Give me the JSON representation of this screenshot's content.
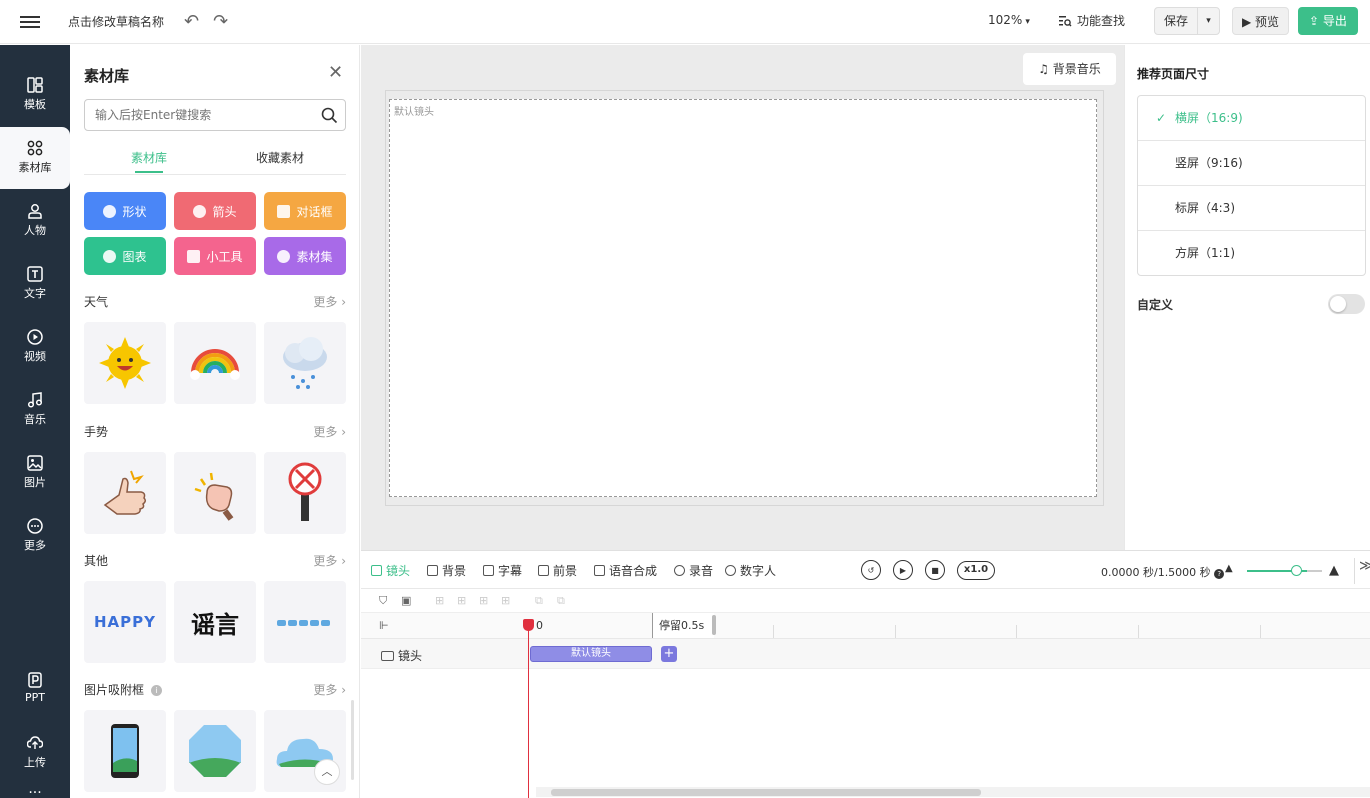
{
  "topbar": {
    "draft_name": "点击修改草稿名称",
    "zoom": "102%",
    "func_search": "功能查找",
    "save": "保存",
    "preview": "预览",
    "export": "导出"
  },
  "nav": {
    "items": [
      {
        "label": "模板",
        "icon": "template-icon"
      },
      {
        "label": "素材库",
        "icon": "material-library-icon"
      },
      {
        "label": "人物",
        "icon": "person-icon"
      },
      {
        "label": "文字",
        "icon": "text-icon"
      },
      {
        "label": "视频",
        "icon": "video-icon"
      },
      {
        "label": "音乐",
        "icon": "music-icon"
      },
      {
        "label": "图片",
        "icon": "image-icon"
      },
      {
        "label": "更多",
        "icon": "more-icon"
      },
      {
        "label": "PPT",
        "icon": "ppt-icon"
      },
      {
        "label": "上传",
        "icon": "upload-icon"
      }
    ],
    "overflow": "···"
  },
  "panel": {
    "title": "素材库",
    "search_placeholder": "输入后按Enter键搜索",
    "tabs": [
      "素材库",
      "收藏素材"
    ],
    "categories": [
      {
        "label": "形状",
        "color": "#4a86f7"
      },
      {
        "label": "箭头",
        "color": "#f06a73"
      },
      {
        "label": "对话框",
        "color": "#f5a742"
      },
      {
        "label": "图表",
        "color": "#2ec28f"
      },
      {
        "label": "小工具",
        "color": "#f4648e"
      },
      {
        "label": "素材集",
        "color": "#a86ae8"
      }
    ],
    "sections": [
      {
        "title": "天气",
        "more": "更多"
      },
      {
        "title": "手势",
        "more": "更多"
      },
      {
        "title": "其他",
        "more": "更多"
      },
      {
        "title": "图片吸附框",
        "more": "更多"
      }
    ],
    "other_texts": [
      "HAPPY",
      "谣言"
    ]
  },
  "canvas": {
    "bgm": "背景音乐",
    "stage_label": "默认镜头"
  },
  "right": {
    "title": "推荐页面尺寸",
    "sizes": [
      "横屏（16:9)",
      "竖屏（9:16)",
      "标屏（4:3)",
      "方屏（1:1)"
    ],
    "custom": "自定义"
  },
  "timeline": {
    "tabs": [
      "镜头",
      "背景",
      "字幕",
      "前景",
      "语音合成",
      "录音",
      "数字人"
    ],
    "speed": "x1.0",
    "timecode": "0.0000 秒/1.5000 秒",
    "ruler_zero": "0",
    "pause": "停留0.5s",
    "track_label": "镜头",
    "clip_label": "默认镜头",
    "add": "+"
  },
  "colors": {
    "accent": "#3cbf8a",
    "nav_bg": "#23303e",
    "playhead": "#e0303f",
    "clip": "#8f8de6"
  }
}
